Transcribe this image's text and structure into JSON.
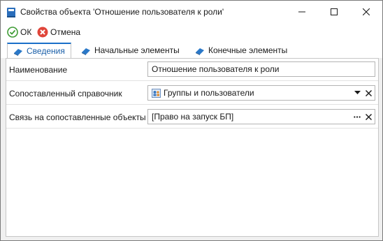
{
  "window": {
    "title": "Свойства объекта 'Отношение пользователя к роли'",
    "icons": {
      "app": "book-icon",
      "minimize": "minimize-icon",
      "maximize": "maximize-icon",
      "close": "close-icon"
    }
  },
  "toolbar": {
    "ok_label": "ОК",
    "cancel_label": "Отмена",
    "ok_icon": "check-circle-icon",
    "cancel_icon": "x-circle-icon",
    "colors": {
      "ok": "#3f9c35",
      "cancel": "#e0453a"
    }
  },
  "tabs": [
    {
      "label": "Сведения",
      "active": true,
      "icon": "book-icon"
    },
    {
      "label": "Начальные элементы",
      "active": false,
      "icon": "book-icon"
    },
    {
      "label": "Конечные элементы",
      "active": false,
      "icon": "book-icon"
    }
  ],
  "form": {
    "fields": [
      {
        "label": "Наименование",
        "value": "Отношение пользователя к роли"
      },
      {
        "label": "Сопоставленный справочник",
        "value": "Группы и пользователи",
        "icon": "directory-icon",
        "buttons": [
          "dropdown",
          "clear"
        ]
      },
      {
        "label": "Связь на сопоставленные объекты",
        "value": "[Право на запуск БП]",
        "buttons": [
          "ellipsis",
          "clear"
        ]
      }
    ]
  },
  "colors": {
    "accent": "#1a6fc9",
    "active_tab_text": "#1a5fa8"
  }
}
